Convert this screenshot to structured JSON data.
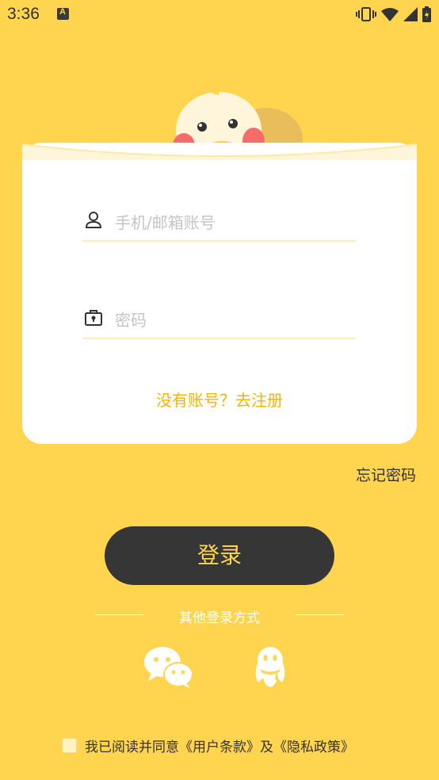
{
  "status_bar": {
    "time": "3:36"
  },
  "login_form": {
    "phone_placeholder": "手机/邮箱账号",
    "password_placeholder": "密码",
    "register_link": "没有账号？去注册"
  },
  "forgot_password": "忘记密码",
  "login_button": "登录",
  "other_login": {
    "label": "其他登录方式",
    "methods": [
      "wechat-icon",
      "qq-icon"
    ]
  },
  "agreement": {
    "text": "我已阅读并同意《用户条款》及《隐私政策》",
    "checked": false
  },
  "colors": {
    "background": "#FFD54F",
    "accent": "#F5B400",
    "button": "#363636"
  }
}
